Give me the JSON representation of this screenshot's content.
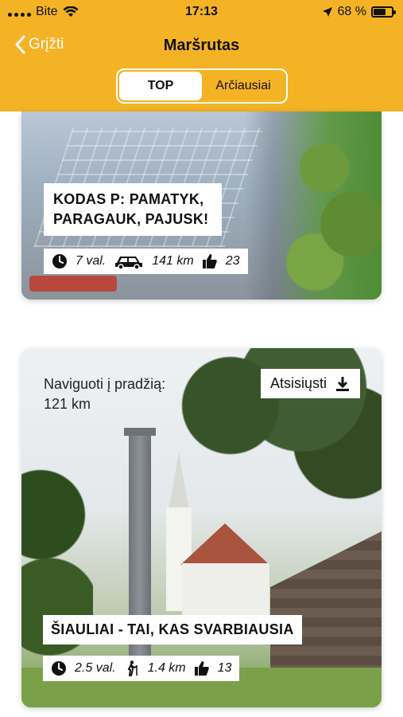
{
  "status_bar": {
    "carrier": "Bite",
    "time": "17:13",
    "battery_text": "68 %",
    "battery_level": 0.68
  },
  "header": {
    "back_label": "Grįžti",
    "title": "Maršrutas",
    "tabs": [
      {
        "label": "TOP",
        "active": true
      },
      {
        "label": "Arčiausiai",
        "active": false
      }
    ]
  },
  "routes": [
    {
      "title_line1": "KODAS P: PAMATYK,",
      "title_line2": "PARAGAUK, PAJUSK!",
      "duration": "7 val.",
      "distance": "141 km",
      "likes": "23",
      "transport_icon": "car-icon"
    },
    {
      "navigate_line1": "Naviguoti į pradžią:",
      "navigate_line2": "121 km",
      "download_label": "Atsisiųsti",
      "title": "ŠIAULIAI - TAI, KAS SVARBIAUSIA",
      "duration": "2.5 val.",
      "distance": "1.4 km",
      "likes": "13",
      "transport_icon": "hiking-icon"
    }
  ],
  "colors": {
    "accent": "#f4b325"
  }
}
